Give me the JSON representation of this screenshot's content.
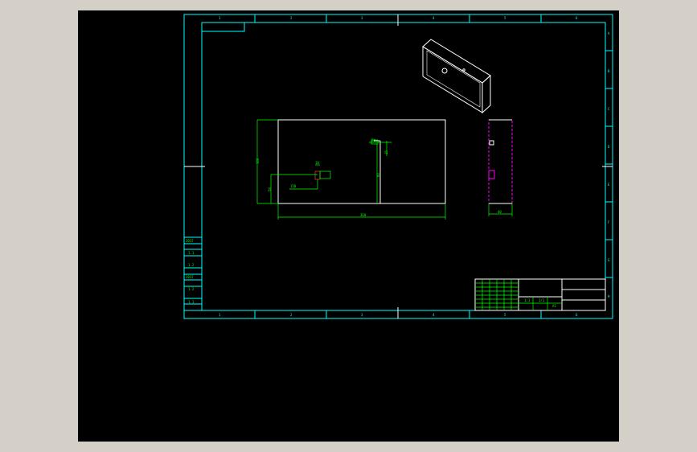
{
  "drawing": {
    "zone_columns_top": [
      "1",
      "2",
      "3",
      "4",
      "5",
      "6"
    ],
    "zone_columns_bottom": [
      "1",
      "2",
      "3",
      "4",
      "5",
      "6"
    ],
    "zone_rows_right": [
      "A",
      "B",
      "C",
      "D",
      "E",
      "F",
      "G",
      "H"
    ],
    "dimensions": {
      "overall_width": "360",
      "overall_height": "180",
      "hole_x": "150",
      "hole_y": "58",
      "hole_size": "10",
      "slot_depth": "60",
      "slot_width": "15",
      "slot_offset": "50",
      "side_width": "40"
    },
    "revision_block": [
      "2017",
      "1.1",
      "1.2",
      "2017",
      "1.2",
      "1.1"
    ],
    "title_block": {
      "scale": "1:1",
      "sheet": "1/1",
      "rev": "A1"
    },
    "colors": {
      "background": "#000000",
      "frame": "#00ffff",
      "geometry": "#ffffff",
      "dimension": "#00ff00",
      "hidden": "#ff00ff",
      "window": "#d4d0c8"
    }
  }
}
